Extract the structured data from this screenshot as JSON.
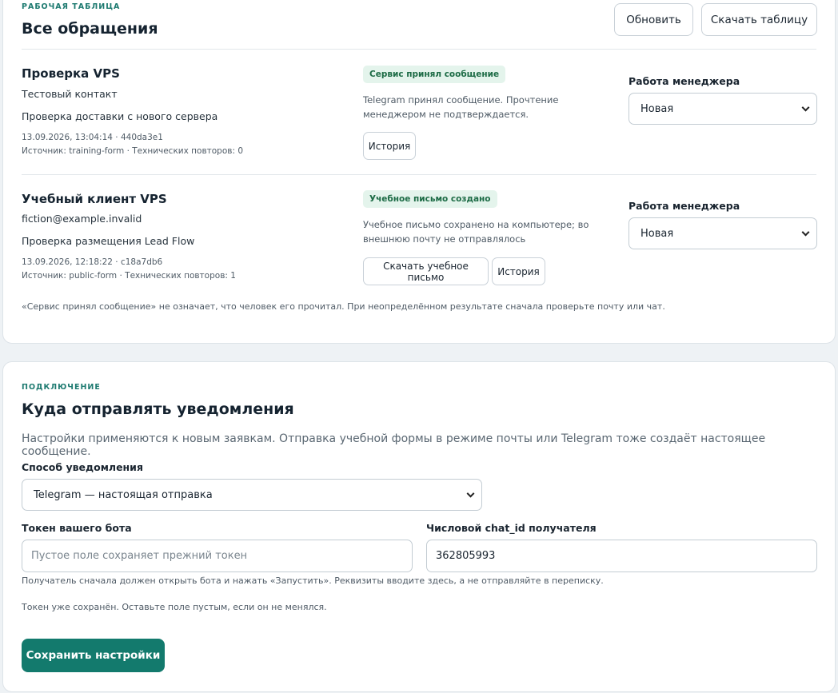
{
  "worktable": {
    "eyebrow": "РАБОЧАЯ ТАБЛИЦА",
    "title": "Все обращения",
    "refresh_label": "Обновить",
    "download_label": "Скачать таблицу",
    "rows": [
      {
        "name": "Проверка VPS",
        "contact": "Тестовый контакт",
        "message": "Проверка доставки с нового сервера",
        "meta1": "13.09.2026, 13:04:14 · 440da3e1",
        "meta2": "Источник: training-form · Технических повторов: 0",
        "badge": "Сервис принял сообщение",
        "status_text": "Telegram принял сообщение. Прочтение менеджером не подтверждается.",
        "history_label": "История",
        "manager_label": "Работа менеджера",
        "manager_value": "Новая"
      },
      {
        "name": "Учебный клиент VPS",
        "contact": "fiction@example.invalid",
        "message": "Проверка размещения Lead Flow",
        "meta1": "13.09.2026, 12:18:22 · c18a7db6",
        "meta2": "Источник: public-form · Технических повторов: 1",
        "badge": "Учебное письмо создано",
        "status_text": "Учебное письмо сохранено на компьютере; во внешнюю почту не отправлялось",
        "download_letter_label": "Скачать учебное письмо",
        "history_label": "История",
        "manager_label": "Работа менеджера",
        "manager_value": "Новая"
      }
    ],
    "footnote": "«Сервис принял сообщение» не означает, что человек его прочитал. При неопределённом результате сначала проверьте почту или чат."
  },
  "connection": {
    "eyebrow": "ПОДКЛЮЧЕНИЕ",
    "title": "Куда отправлять уведомления",
    "lead": "Настройки применяются к новым заявкам. Отправка учебной формы в режиме почты или Telegram тоже создаёт настоящее сообщение.",
    "method_label": "Способ уведомления",
    "method_value": "Telegram — настоящая отправка",
    "token_label": "Токен вашего бота",
    "token_placeholder": "Пустое поле сохраняет прежний токен",
    "chat_label": "Числовой chat_id получателя",
    "chat_value": "362805993",
    "hint": "Получатель сначала должен открыть бота и нажать «Запустить». Реквизиты вводите здесь, а не отправляйте в переписку.",
    "token_saved": "Токен уже сохранён. Оставьте поле пустым, если он не менялся.",
    "save_label": "Сохранить настройки"
  },
  "colors": {
    "accent": "#137a6d",
    "badge_bg": "#e4f4ec",
    "badge_text": "#1c6b45",
    "page_bg": "#eef2f5"
  }
}
